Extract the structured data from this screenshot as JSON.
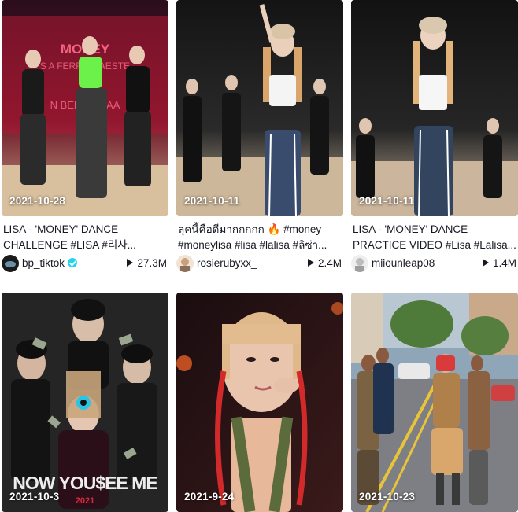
{
  "videos": [
    {
      "date": "2021-10-28",
      "description": "LISA - 'MONEY' DANCE CHALLENGE #LISA #리사...",
      "username": "bp_tiktok",
      "verified": true,
      "views": "27.3M",
      "avatar_icon": "blackpink-logo-avatar"
    },
    {
      "date": "2021-10-11",
      "description": "ลุคนี้คือดีมากกกกก 🔥 #money #moneylisa #lisa #lalisa #ลิซ่า...",
      "username": "rosierubyxx_",
      "verified": false,
      "views": "2.4M",
      "avatar_icon": "user-avatar"
    },
    {
      "date": "2021-10-11",
      "description": "LISA - 'MONEY' DANCE PRACTICE VIDEO #Lisa #Lalisa...",
      "username": "miiounleap08",
      "verified": false,
      "views": "1.4M",
      "avatar_icon": "user-avatar"
    },
    {
      "date": "2021-10-3",
      "poster_text": "NOW YOU$EE ME",
      "poster_year": "2021"
    },
    {
      "date": "2021-9-24"
    },
    {
      "date": "2021-10-23"
    }
  ],
  "colors": {
    "text": "#161823",
    "verified_badge": "#20d5ec",
    "date_text": "#ffffff"
  }
}
